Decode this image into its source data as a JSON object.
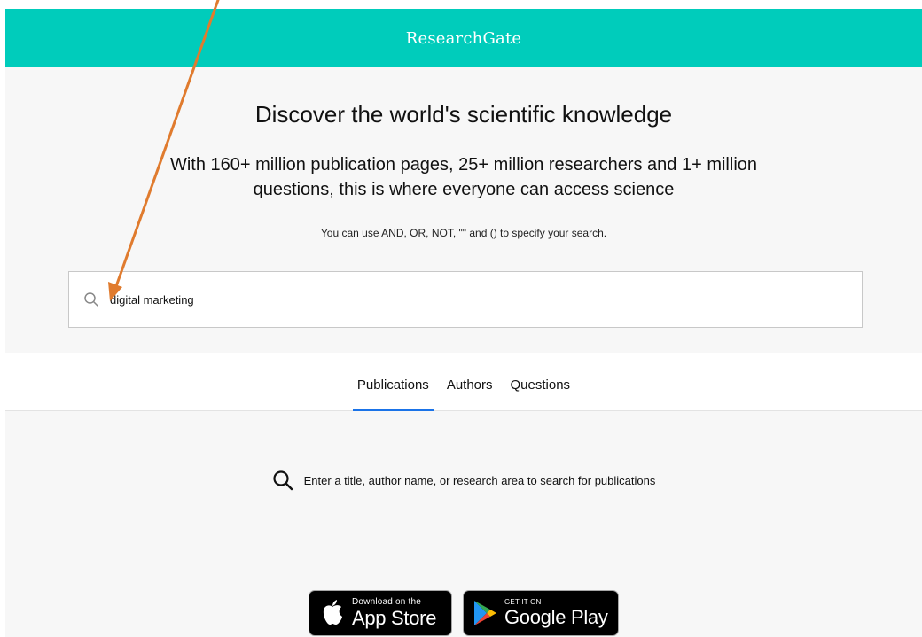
{
  "header": {
    "brand": "ResearchGate",
    "bg_color": "#00ccbb"
  },
  "hero": {
    "headline": "Discover the world's scientific knowledge",
    "subhead": "With 160+ million publication pages, 25+ million researchers and 1+ million questions, this is where everyone can access science",
    "hint": "You can use AND, OR, NOT, \"\" and () to specify your search."
  },
  "search": {
    "icon": "search-icon",
    "value": "digital marketing"
  },
  "tabs": [
    {
      "label": "Publications",
      "active": true
    },
    {
      "label": "Authors",
      "active": false
    },
    {
      "label": "Questions",
      "active": false
    }
  ],
  "active_tab_color": "#1a73e8",
  "empty_state": {
    "icon": "search-icon",
    "text": "Enter a title, author name, or research area to search for publications"
  },
  "store_badges": {
    "app_store": {
      "small": "Download on the",
      "big": "App Store",
      "icon": "apple-icon"
    },
    "google_play": {
      "small": "GET IT ON",
      "big": "Google Play",
      "icon": "google-play-icon"
    }
  },
  "annotation": {
    "arrow_color": "#e07b2e",
    "type": "arrow-pointer"
  }
}
